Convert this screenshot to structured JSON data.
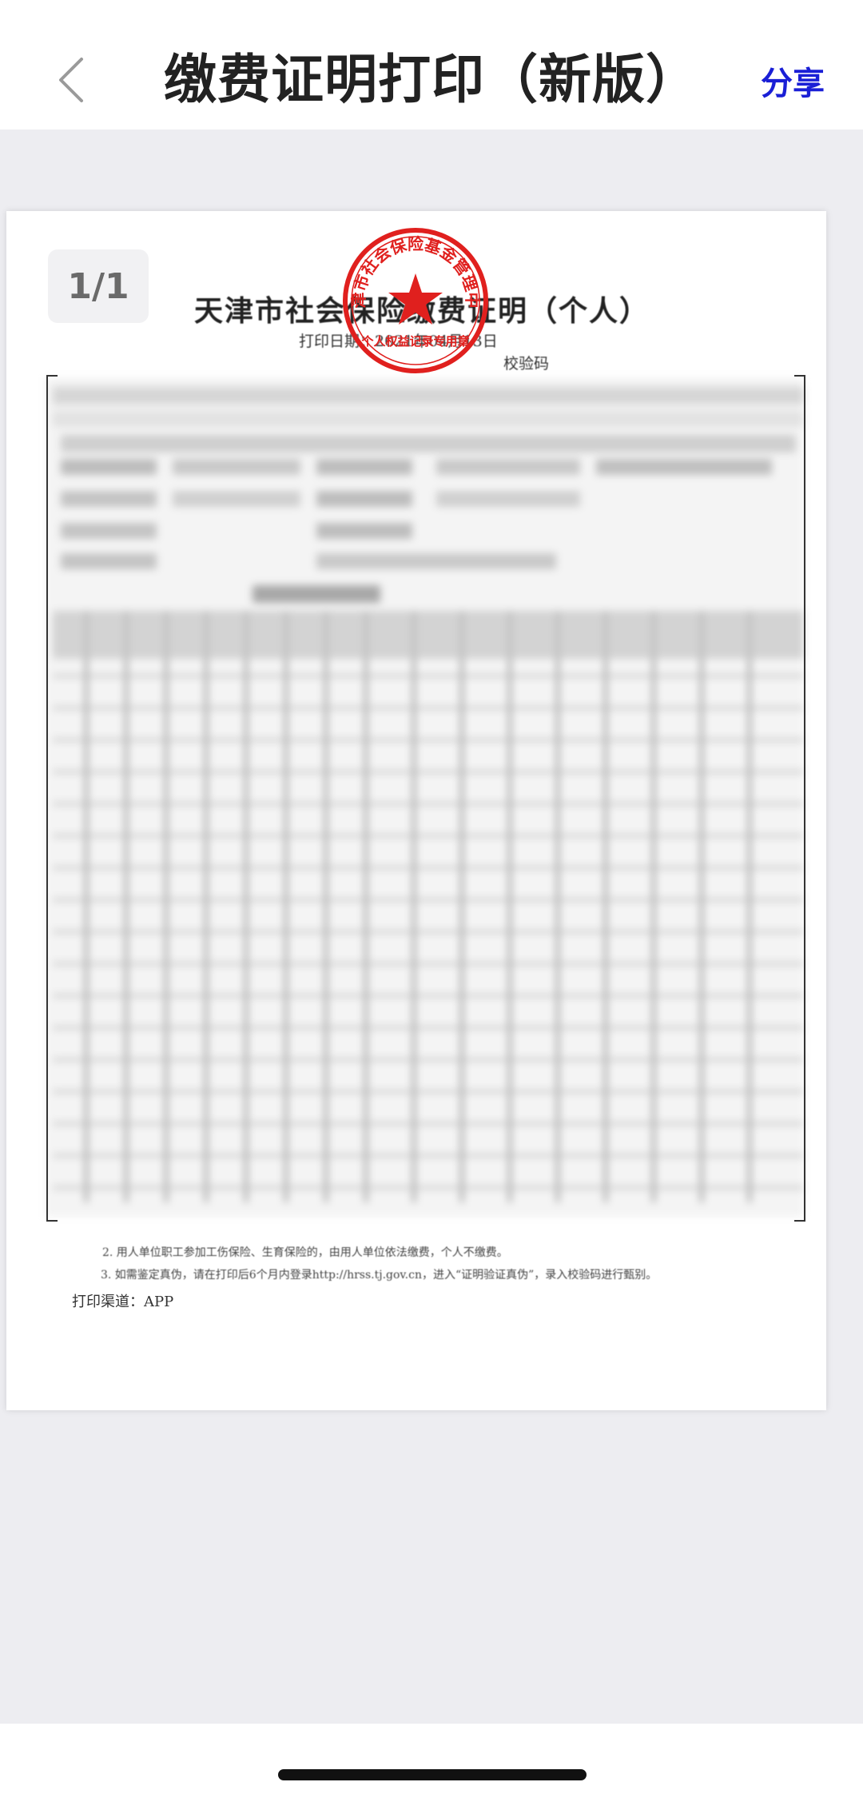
{
  "header": {
    "title": "缴费证明打印（新版）",
    "share_label": "分享",
    "back_icon": "chevron-left-icon"
  },
  "viewer": {
    "page_indicator": "1/1"
  },
  "document": {
    "title": "天津市社会保险缴费证明（个人）",
    "print_date": "打印日期：2021年04月13日",
    "verify_code_label": "校验码",
    "notes": {
      "note_2": "2. 用人单位职工参加工伤保险、生育保险的，由用人单位依法缴费，个人不缴费。",
      "note_3": "3. 如需鉴定真伪，请在打印后6个月内登录http://hrss.tj.gov.cn，进入“证明验证真伪”，录入校验码进行甄别。"
    },
    "print_channel": "打印渠道：APP",
    "seal": {
      "text": "天津市社会保险基金管理中心",
      "subtext": "个人权益记录专用章",
      "color": "#e0201e"
    }
  },
  "colors": {
    "accent": "#1a1fd6",
    "viewer_bg": "#ededf1",
    "seal_red": "#e0201e"
  }
}
